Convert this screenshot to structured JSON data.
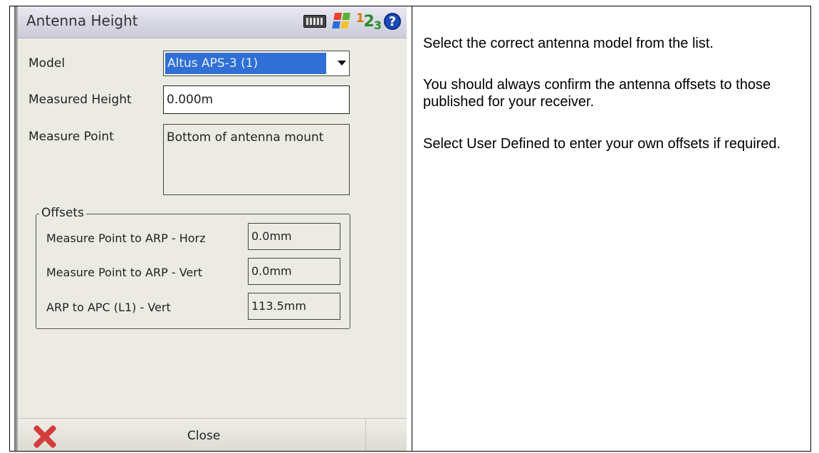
{
  "window": {
    "title": "Antenna Height",
    "icons": [
      "keyboard-icon",
      "windows-flag-icon",
      "input-mode-123-icon",
      "help-icon"
    ],
    "input_mode": {
      "one": "1",
      "two": "2",
      "three": "3"
    },
    "help_glyph": "?"
  },
  "form": {
    "model_label": "Model",
    "model_value": "Altus APS-3 (1)",
    "measured_height_label": "Measured Height",
    "measured_height_value": "0.000m",
    "measure_point_label": "Measure Point",
    "measure_point_value": "Bottom of antenna mount"
  },
  "offsets": {
    "legend": "Offsets",
    "rows": [
      {
        "label": "Measure Point to ARP - Horz",
        "value": "0.0mm"
      },
      {
        "label": "Measure Point to ARP - Vert",
        "value": "0.0mm"
      },
      {
        "label": "ARP to APC (L1) - Vert",
        "value": "113.5mm"
      }
    ]
  },
  "bottom_bar": {
    "close_label": "Close"
  },
  "help": {
    "paragraphs": [
      "Select the correct antenna model from the list.",
      "You should always confirm the antenna offsets to those published for your receiver.",
      "Select User Defined to enter your own offsets if required."
    ]
  },
  "colors": {
    "selection": "#2f6fd6",
    "screen_bg": "#ecebe3",
    "close_red": "#d43c3c",
    "help_blue": "#1d4bb8"
  }
}
